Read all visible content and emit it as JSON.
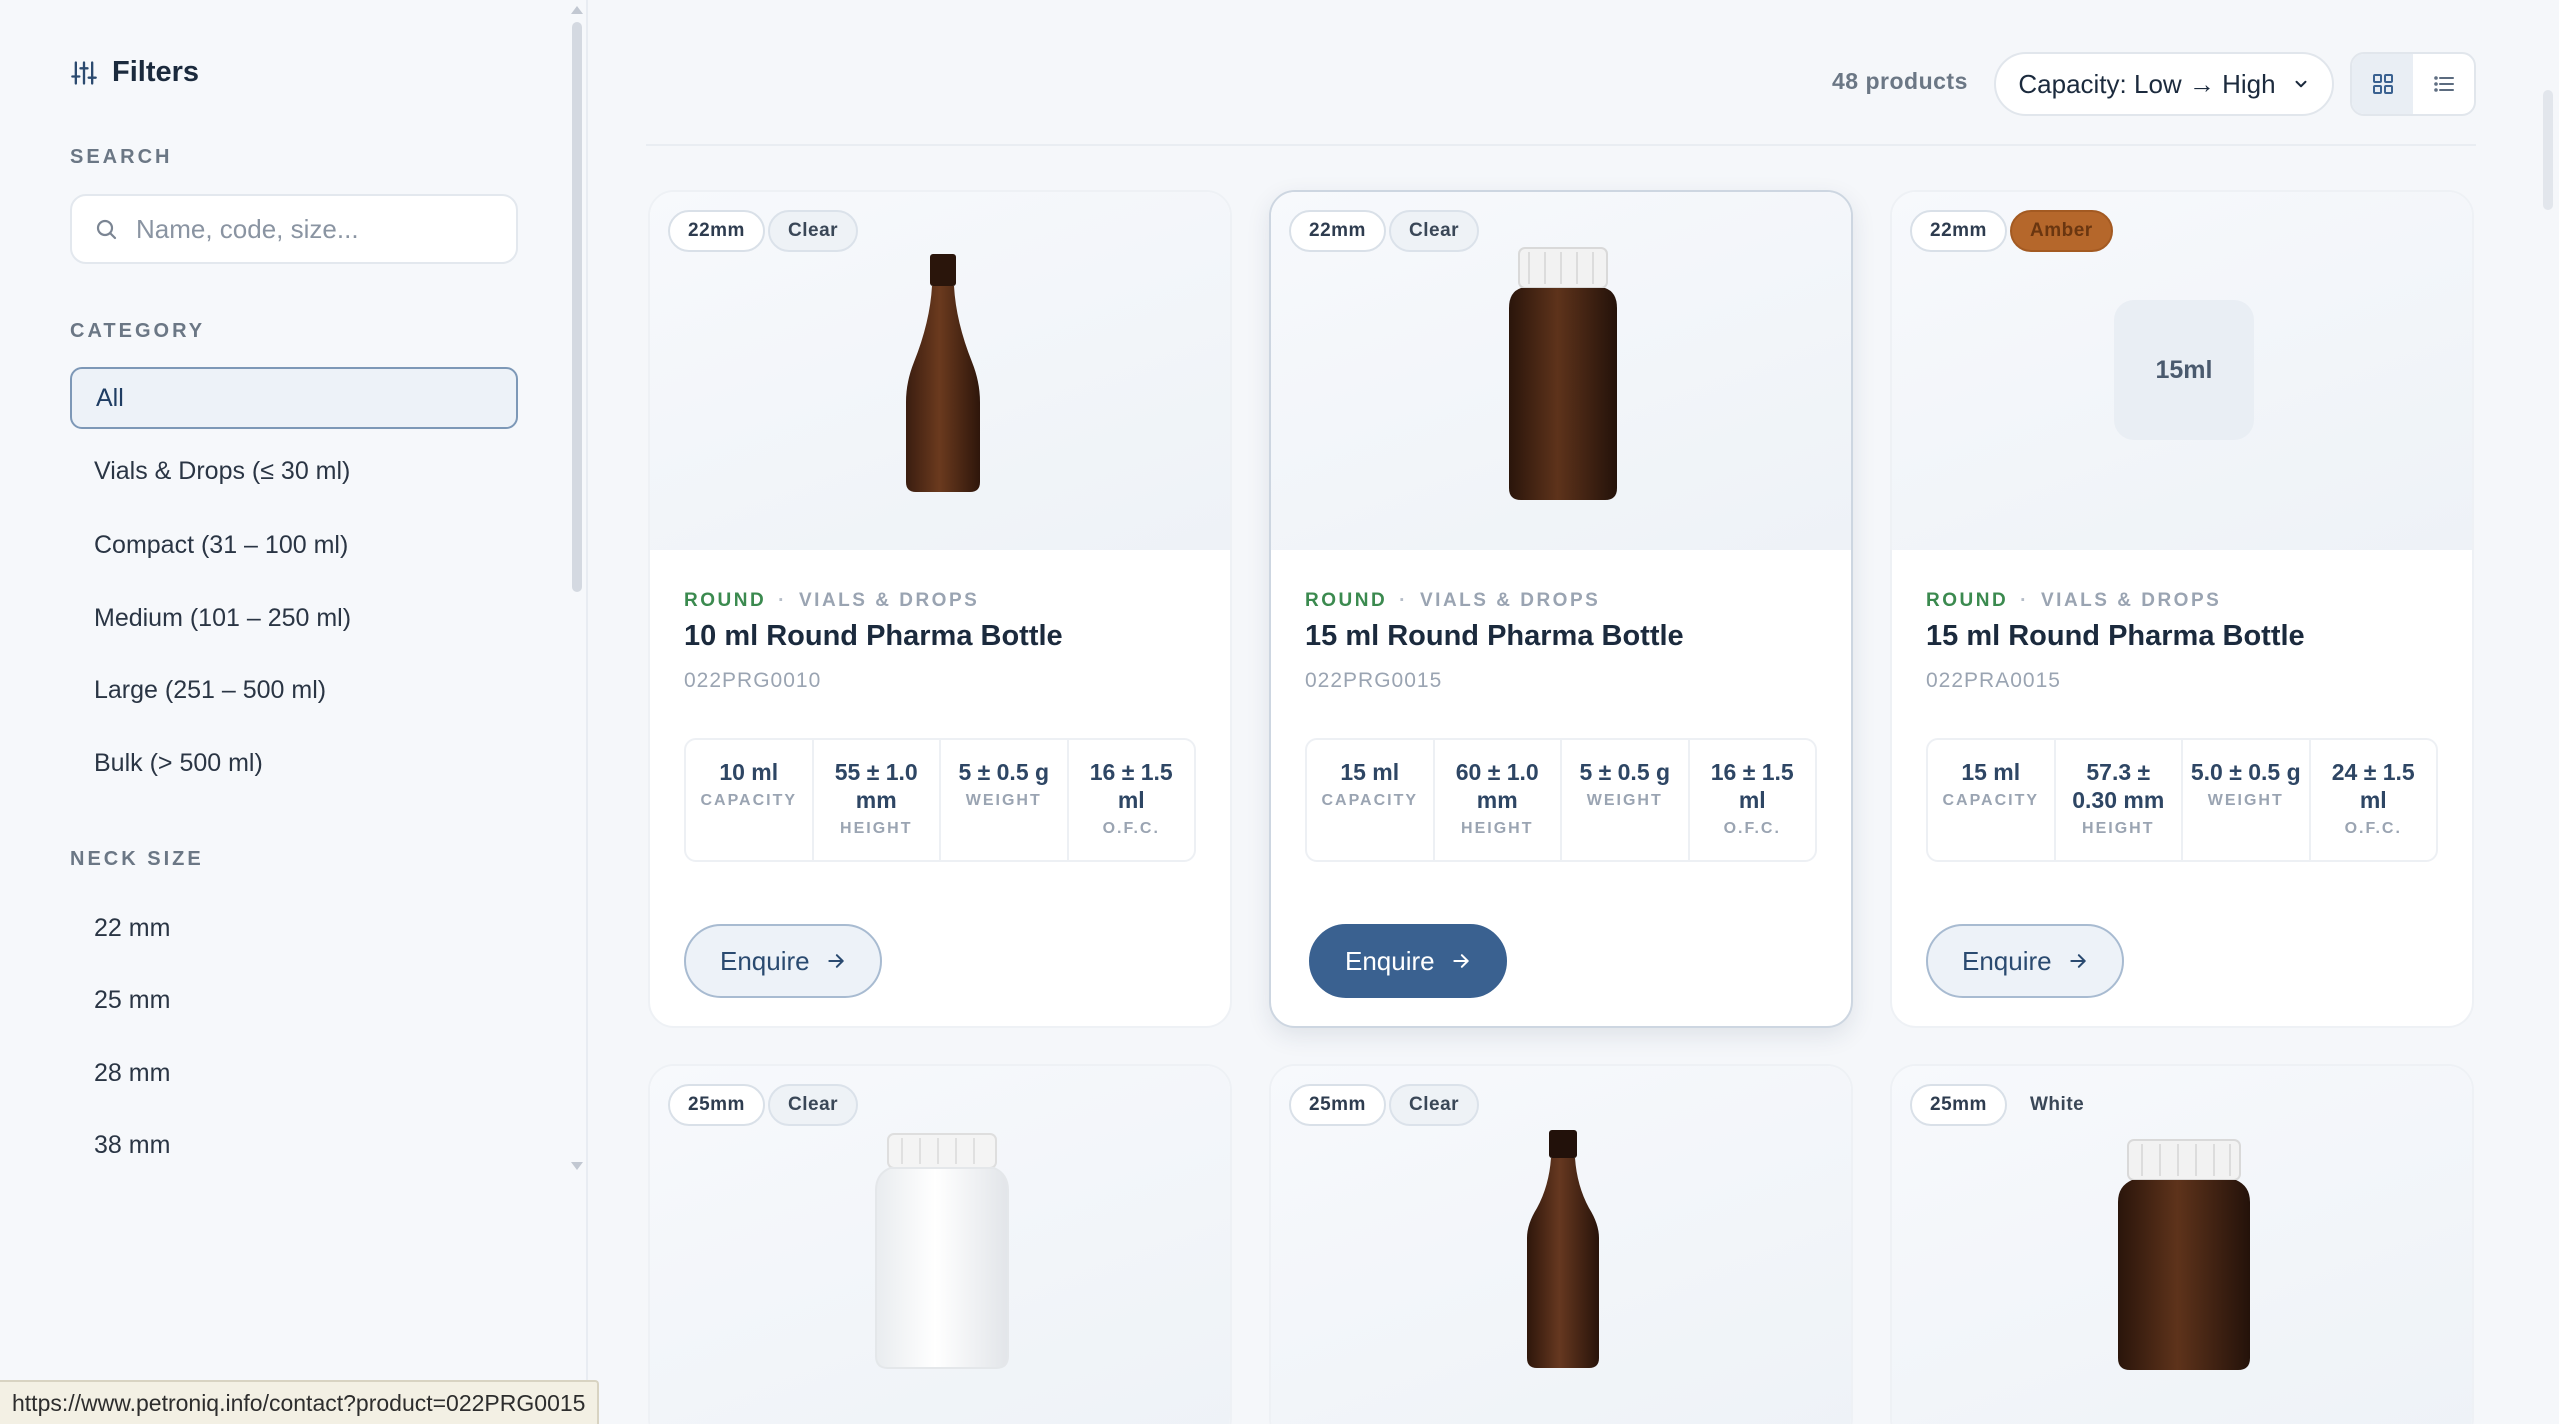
{
  "sidebar": {
    "title": "Filters",
    "search": {
      "label": "SEARCH",
      "placeholder": "Name, code, size..."
    },
    "category": {
      "label": "CATEGORY",
      "items": [
        "All",
        "Vials & Drops (≤ 30 ml)",
        "Compact (31 – 100 ml)",
        "Medium (101 – 250 ml)",
        "Large (251 – 500 ml)",
        "Bulk (> 500 ml)"
      ],
      "selected": "All"
    },
    "neck_size": {
      "label": "NECK SIZE",
      "items": [
        "22 mm",
        "25 mm",
        "28 mm",
        "38 mm"
      ]
    }
  },
  "toolbar": {
    "count": "48 products",
    "sort": "Capacity: Low → High",
    "view": "grid"
  },
  "colors": {
    "accent": "#3a6190",
    "shape_green": "#3b8a4f",
    "amber_chip": "#b5672b"
  },
  "products": [
    {
      "neck": "22mm",
      "color_tag": "Clear",
      "shape": "ROUND",
      "category": "VIALS & DROPS",
      "title": "10 ml Round Pharma Bottle",
      "code": "022PRG0010",
      "specs": [
        {
          "value": "10 ml",
          "label": "CAPACITY"
        },
        {
          "value": "55 ± 1.0 mm",
          "label": "HEIGHT"
        },
        {
          "value": "5 ± 0.5 g",
          "label": "WEIGHT"
        },
        {
          "value": "16 ± 1.5 ml",
          "label": "O.F.C."
        }
      ],
      "cta": "Enquire"
    },
    {
      "neck": "22mm",
      "color_tag": "Clear",
      "shape": "ROUND",
      "category": "VIALS & DROPS",
      "title": "15 ml Round Pharma Bottle",
      "code": "022PRG0015",
      "specs": [
        {
          "value": "15 ml",
          "label": "CAPACITY"
        },
        {
          "value": "60 ± 1.0 mm",
          "label": "HEIGHT"
        },
        {
          "value": "5 ± 0.5 g",
          "label": "WEIGHT"
        },
        {
          "value": "16 ± 1.5 ml",
          "label": "O.F.C."
        }
      ],
      "cta": "Enquire"
    },
    {
      "neck": "22mm",
      "color_tag": "Amber",
      "shape": "ROUND",
      "category": "VIALS & DROPS",
      "title": "15 ml Round Pharma Bottle",
      "code": "022PRA0015",
      "placeholder": "15ml",
      "specs": [
        {
          "value": "15 ml",
          "label": "CAPACITY"
        },
        {
          "value": "57.3 ± 0.30 mm",
          "label": "HEIGHT"
        },
        {
          "value": "5.0 ± 0.5 g",
          "label": "WEIGHT"
        },
        {
          "value": "24 ± 1.5 ml",
          "label": "O.F.C."
        }
      ],
      "cta": "Enquire"
    },
    {
      "neck": "25mm",
      "color_tag": "Clear"
    },
    {
      "neck": "25mm",
      "color_tag": "Clear"
    },
    {
      "neck": "25mm",
      "color_tag": "White"
    }
  ],
  "status_url": "https://www.petroniq.info/contact?product=022PRG0015"
}
